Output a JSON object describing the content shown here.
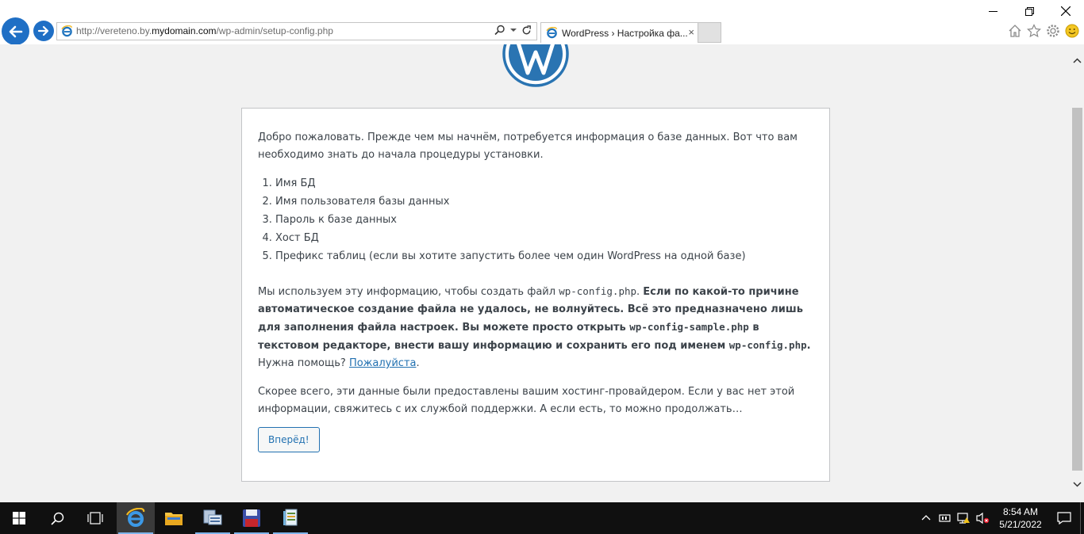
{
  "browser": {
    "url_prefix": "http://vereteno.by.",
    "url_domain": "mydomain.com",
    "url_path": "/wp-admin/setup-config.php",
    "tab_title": "WordPress › Настройка фа...",
    "tab_close": "×"
  },
  "page": {
    "intro": "Добро пожаловать. Прежде чем мы начнём, потребуется информация о базе данных. Вот что вам необходимо знать до начала процедуры установки.",
    "items": [
      "Имя БД",
      "Имя пользователя базы данных",
      "Пароль к базе данных",
      "Хост БД",
      "Префикс таблиц (если вы хотите запустить более чем один WordPress на одной базе)"
    ],
    "info_1": "Мы используем эту информацию, чтобы создать файл ",
    "info_file_1": "wp-config.php",
    "info_2": ". ",
    "info_bold_1": "Если по какой-то причине автоматическое создание файла не удалось, не волнуйтесь. Всё это предназначено лишь для заполнения файла настроек. Вы можете просто открыть ",
    "info_file_2": "wp-config-sample.php",
    "info_bold_2": " в текстовом редакторе, внести вашу информацию и сохранить его под именем ",
    "info_file_3": "wp-config.php",
    "info_bold_3": ".",
    "info_help": " Нужна помощь? ",
    "help_link": "Пожалуйста",
    "help_after": ".",
    "outro": "Скорее всего, эти данные были предоставлены вашим хостинг-провайдером. Если у вас нет этой информации, свяжитесь с их службой поддержки. А если есть, то можно продолжать…",
    "continue_button": "Вперёд!"
  },
  "taskbar": {
    "time": "8:54 AM",
    "date": "5/21/2022"
  },
  "colors": {
    "accent": "#2271b1",
    "ie_blue": "#1f6fc5",
    "taskbar": "#101010"
  }
}
